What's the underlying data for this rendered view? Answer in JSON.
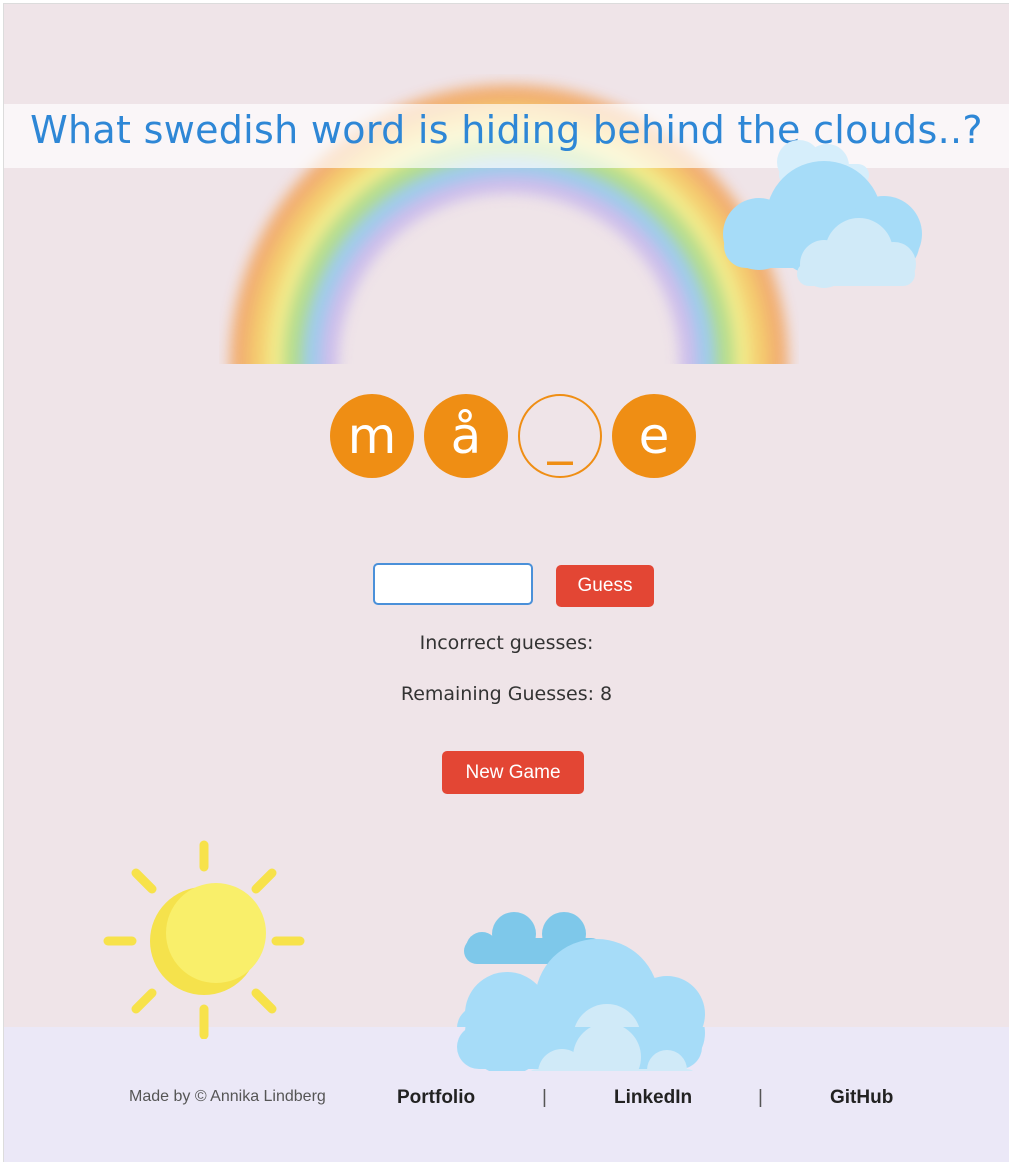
{
  "title": "What swedish word is hiding behind the clouds..?",
  "word": {
    "letters": [
      {
        "char": "m",
        "revealed": true
      },
      {
        "char": "å",
        "revealed": true
      },
      {
        "char": "_",
        "revealed": false
      },
      {
        "char": "e",
        "revealed": true
      }
    ]
  },
  "guess": {
    "input_value": "",
    "button_label": "Guess"
  },
  "status": {
    "incorrect_label": "Incorrect guesses:",
    "remaining_label": "Remaining Guesses: 8",
    "remaining_count": 8
  },
  "new_game_label": "New Game",
  "footer": {
    "credit": "Made by © Annika Lindberg",
    "portfolio": "Portfolio",
    "linkedin": "LinkedIn",
    "github": "GitHub",
    "separator": "|"
  },
  "colors": {
    "background": "#efe4e8",
    "title": "#2e87d6",
    "tile": "#ef8e14",
    "button": "#e34634",
    "footer": "#ebe8f7",
    "sun": "#f7e24a",
    "cloud": "#a8dcf7"
  },
  "icons": [
    "rainbow-icon",
    "cloud-icon",
    "sun-icon"
  ]
}
